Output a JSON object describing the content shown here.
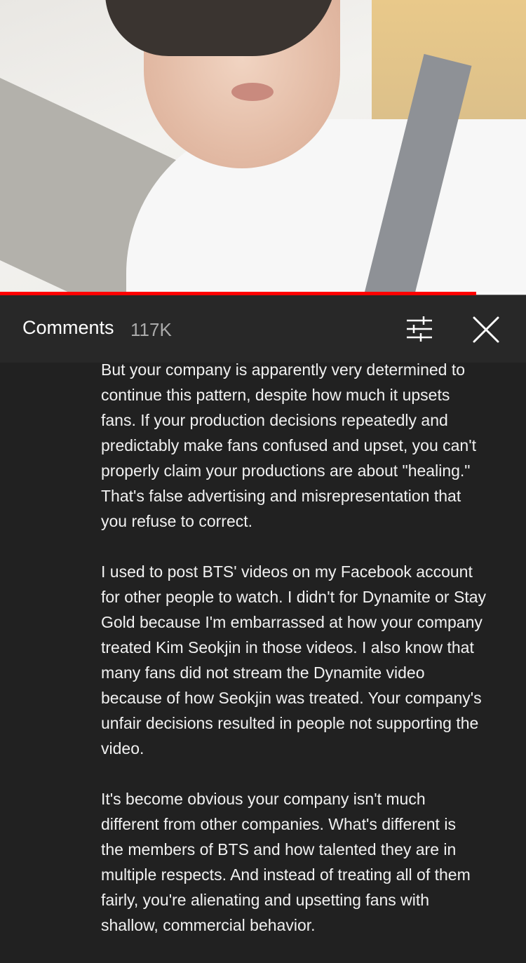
{
  "video": {
    "progress_fraction": 0.905
  },
  "comments_panel": {
    "title": "Comments",
    "count": "117K",
    "filter_icon": "sort-filter-icon",
    "close_icon": "close-icon"
  },
  "comment": {
    "paragraphs": [
      "But your company is apparently very determined to\ncontinue this pattern, despite how much it upsets\nfans. If your production decisions repeatedly and\npredictably make fans confused and upset, you can't\nproperly claim your productions are about \"healing.\"\nThat's false advertising and misrepresentation that\nyou refuse to correct.",
      "I used to post BTS' videos on my Facebook account\nfor other people to watch. I didn't for Dynamite or Stay\nGold because I'm embarrassed at how your company\ntreated Kim Seokjin in those videos. I also know that\nmany fans did not stream the Dynamite video\nbecause of how Seokjin was treated. Your company's\nunfair decisions resulted in people not supporting the\nvideo.",
      "It's become obvious your company isn't much\ndifferent from other companies. What's different is\nthe members of BTS and how talented they are in\nmultiple respects. And instead of treating all of them\nfairly, you're alienating and upsetting fans with\nshallow, commercial behavior."
    ]
  },
  "colors": {
    "progress": "#ff0000",
    "panel_bg": "#212121",
    "header_bg": "#282828",
    "text": "#f1f1f1",
    "muted": "#aaaaaa"
  }
}
